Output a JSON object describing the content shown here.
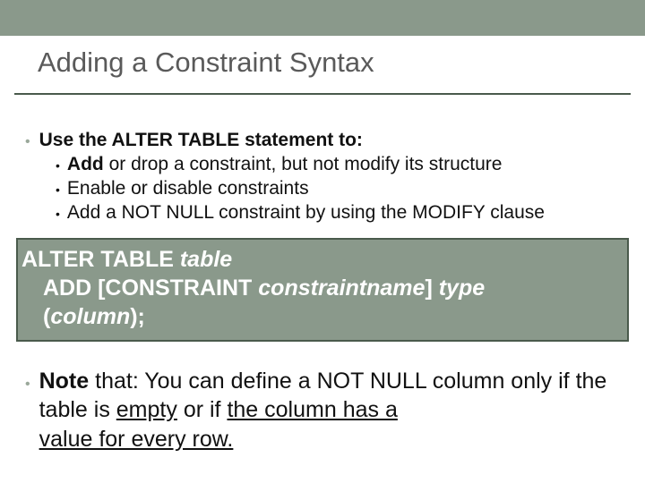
{
  "title": "Adding a Constraint Syntax",
  "bullet_main_lead": "Use the ",
  "bullet_main_code": "ALTER TABLE",
  "bullet_main_tail": " statement to:",
  "sub1_lead": "Add",
  "sub1_tail": " or drop a constraint, but not modify its structure",
  "sub2": "Enable or disable constraints",
  "sub3_a": "Add a ",
  "sub3_code": "NOT NULL",
  "sub3_b": " constraint by using the ",
  "sub3_code2": "MODIFY",
  "sub3_c": " clause",
  "code_l1_a": "ALTER TABLE ",
  "code_l1_b": "table",
  "code_l2_a": "ADD [CONSTRAINT ",
  "code_l2_b": "constraintname",
  "code_l2_c": "] ",
  "code_l2_d": "type",
  "code_l3_a": "(",
  "code_l3_b": "column",
  "code_l3_c": ");",
  "note_lead": "Note",
  "note_tail1": " that: You can define a ",
  "note_code": "NOT NULL",
  "note_tail2": " column only if the table is ",
  "note_u1": "empty",
  "note_mid": " or if ",
  "note_u2": "the column has a ",
  "note_u3": "value for every row."
}
